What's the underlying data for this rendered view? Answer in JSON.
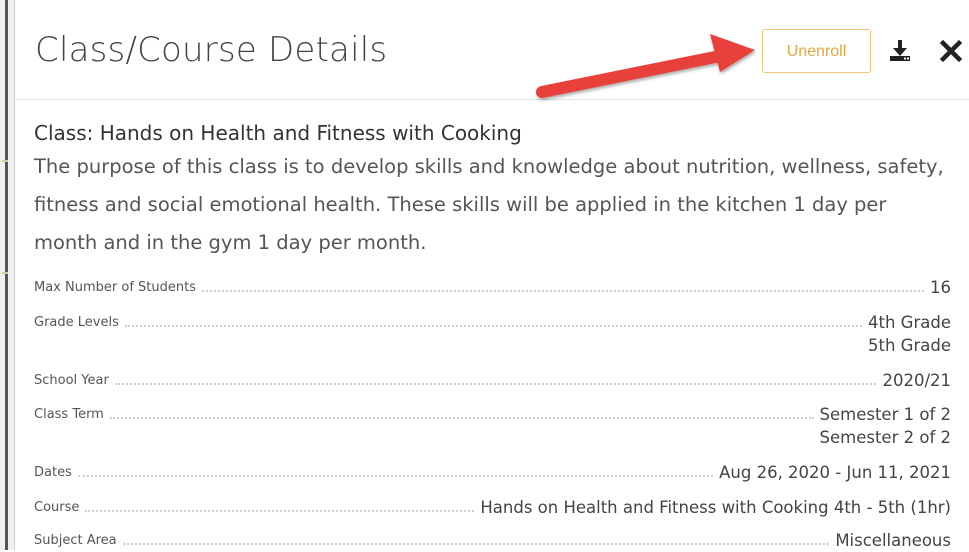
{
  "dialog": {
    "title": "Class/Course Details",
    "unenroll_label": "Unenroll",
    "download_icon": "download-icon",
    "close_icon": "close-icon"
  },
  "class": {
    "name": "Class: Hands on Health and Fitness with Cooking",
    "description": "The purpose of this class is to develop skills and knowledge about nutrition, wellness, safety, fitness and social emotional health. These skills will be applied in the kitchen 1 day per month and in the gym 1 day per month."
  },
  "details": [
    {
      "label": "Max Number of Students",
      "values": [
        "16"
      ]
    },
    {
      "label": "Grade Levels",
      "values": [
        "4th Grade",
        "5th Grade"
      ]
    },
    {
      "label": "School Year",
      "values": [
        "2020/21"
      ]
    },
    {
      "label": "Class Term",
      "values": [
        "Semester 1 of 2",
        "Semester 2 of 2"
      ]
    },
    {
      "label": "Dates",
      "values": [
        "Aug 26, 2020 - Jun 11, 2021"
      ]
    },
    {
      "label": "Course",
      "values": [
        "Hands on Health and Fitness with Cooking 4th - 5th (1hr)"
      ]
    },
    {
      "label": "Subject Area",
      "values": [
        "Miscellaneous"
      ]
    }
  ],
  "colors": {
    "accent_button": "#e9a43c",
    "arrow": "#e8403a"
  }
}
